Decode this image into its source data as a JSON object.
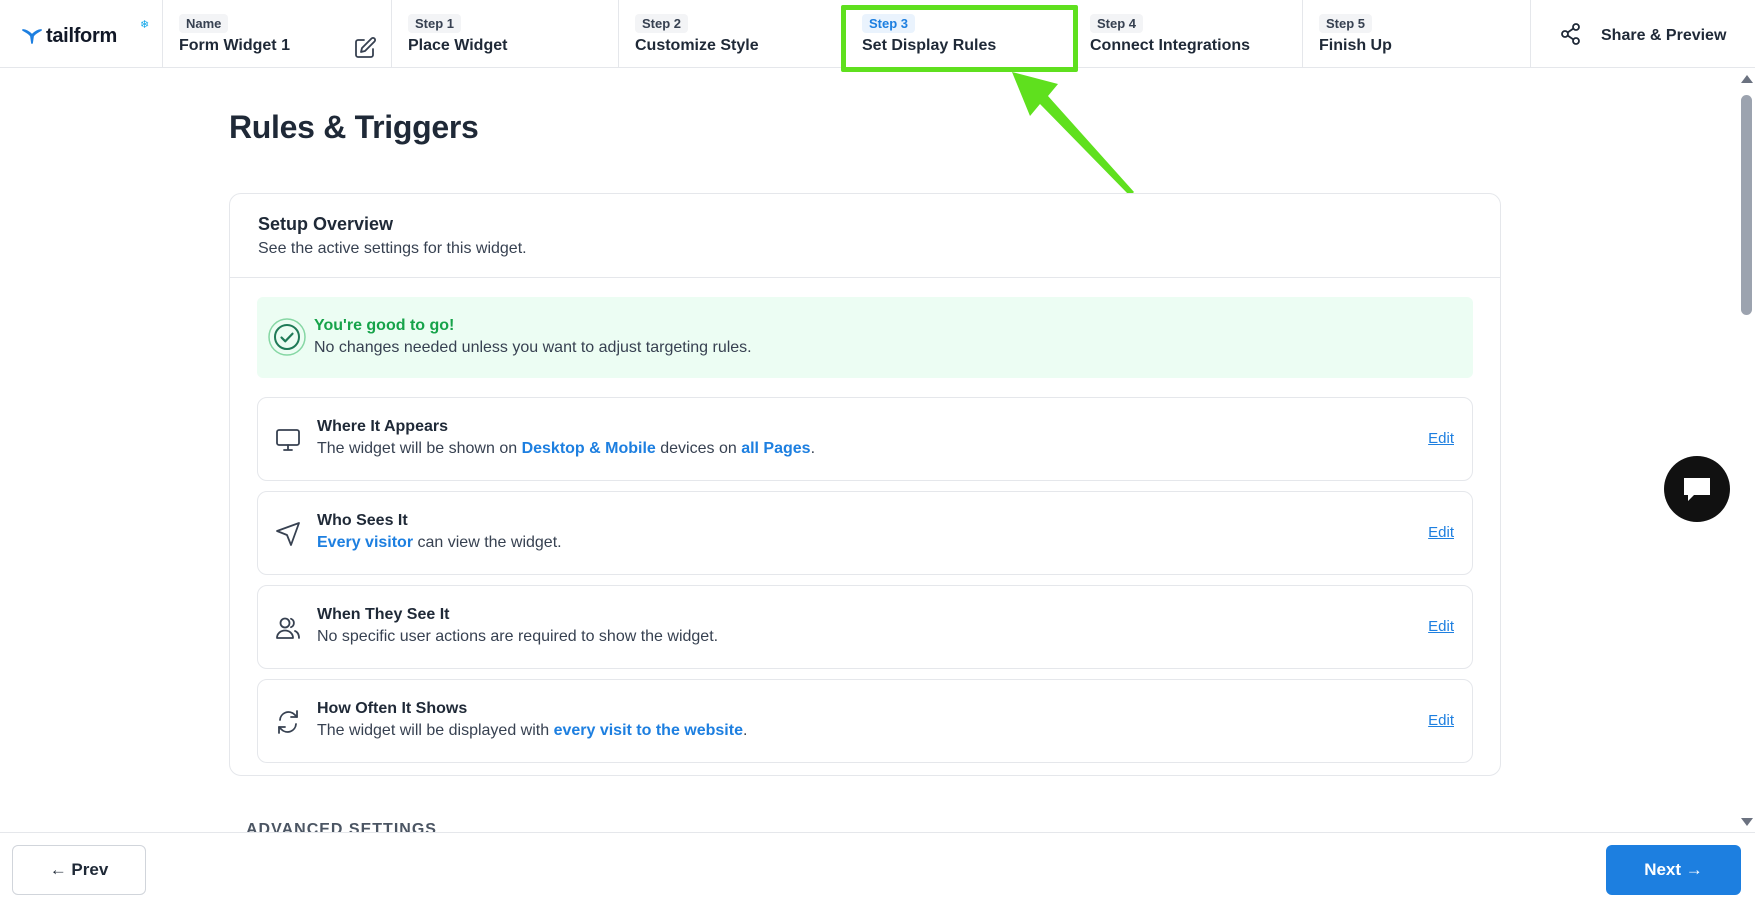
{
  "header": {
    "logo_text": "tailform",
    "name": {
      "label": "Name",
      "value": "Form Widget 1"
    },
    "steps": [
      {
        "step": "Step 1",
        "label": "Place Widget"
      },
      {
        "step": "Step 2",
        "label": "Customize Style"
      },
      {
        "step": "Step 3",
        "label": "Set Display Rules"
      },
      {
        "step": "Step 4",
        "label": "Connect Integrations"
      },
      {
        "step": "Step 5",
        "label": "Finish Up"
      }
    ],
    "active_step": 3,
    "share_label": "Share & Preview"
  },
  "main": {
    "title": "Rules & Triggers",
    "overview": {
      "title": "Setup Overview",
      "subtitle": "See the active settings for this widget.",
      "status": {
        "title": "You're good to go!",
        "text": "No changes needed unless you want to adjust targeting rules."
      },
      "rules": [
        {
          "icon": "monitor-icon",
          "title": "Where It Appears",
          "text_parts": [
            "The widget will be shown on ",
            "Desktop & Mobile",
            " devices on ",
            "all Pages",
            "."
          ],
          "edit": "Edit"
        },
        {
          "icon": "navigation-arrow-icon",
          "title": "Who Sees It",
          "text_parts": [
            "Every visitor",
            " can view the widget."
          ],
          "edit": "Edit"
        },
        {
          "icon": "users-icon",
          "title": "When They See It",
          "text_parts": [
            "No specific user actions are required to show the widget."
          ],
          "edit": "Edit"
        },
        {
          "icon": "refresh-icon",
          "title": "How Often It Shows",
          "text_parts": [
            "The widget will be displayed with ",
            "every visit to the website",
            "."
          ],
          "edit": "Edit"
        }
      ]
    },
    "advanced_label": "ADVANCED SETTINGS"
  },
  "footer": {
    "prev_label": "← Prev",
    "next_label": "Next →"
  },
  "colors": {
    "accent": "#1d7fe0",
    "success": "#16a34a",
    "success_bg": "#ecfdf3",
    "annotation": "#5fe01e"
  }
}
